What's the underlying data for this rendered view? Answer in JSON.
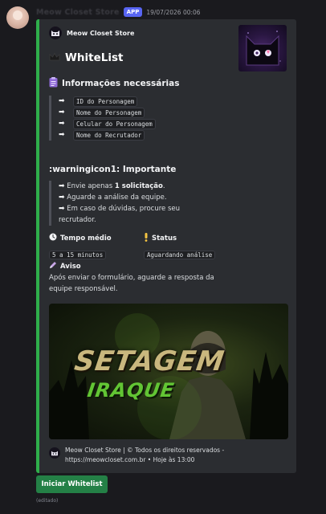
{
  "message": {
    "username": "Meow Closet Store",
    "app_badge": "APP",
    "timestamp": "19/07/2026 00:06",
    "edited_label": "(editado)"
  },
  "embed": {
    "accent_color": "#2fae4b",
    "author": "Meow Closet Store",
    "title": "WhiteList",
    "section_required": {
      "title": "Informações necessárias",
      "items": [
        "ID do Personagem",
        "Nome do Personagem",
        "Celular do Personagem",
        "Nome do Recrutador"
      ]
    },
    "section_important": {
      "title": ":warningicon1: Importante",
      "line1_pre": "Envie apenas ",
      "line1_bold": "1 solicitação",
      "line1_post": ".",
      "line2": "Aguarde a análise da equipe.",
      "line3": "Em caso de dúvidas, procure seu recrutador."
    },
    "fields": {
      "time_name": "Tempo médio",
      "time_value": "5 a 15 minutos",
      "status_name": "Status",
      "status_value": "Aguardando análise",
      "notice_name": "Aviso",
      "notice_text": "Após enviar o formulário, aguarde a resposta da equipe responsável."
    },
    "banner": {
      "line1": "SETAGEM",
      "line2": "IRAQUE"
    },
    "footer": {
      "text": "Meow Closet Store | © Todos os direitos reservados - https://meowcloset.com.br • Hoje às 13:00"
    }
  },
  "button": {
    "label": "Iniciar Whitelist",
    "color": "#248046"
  }
}
